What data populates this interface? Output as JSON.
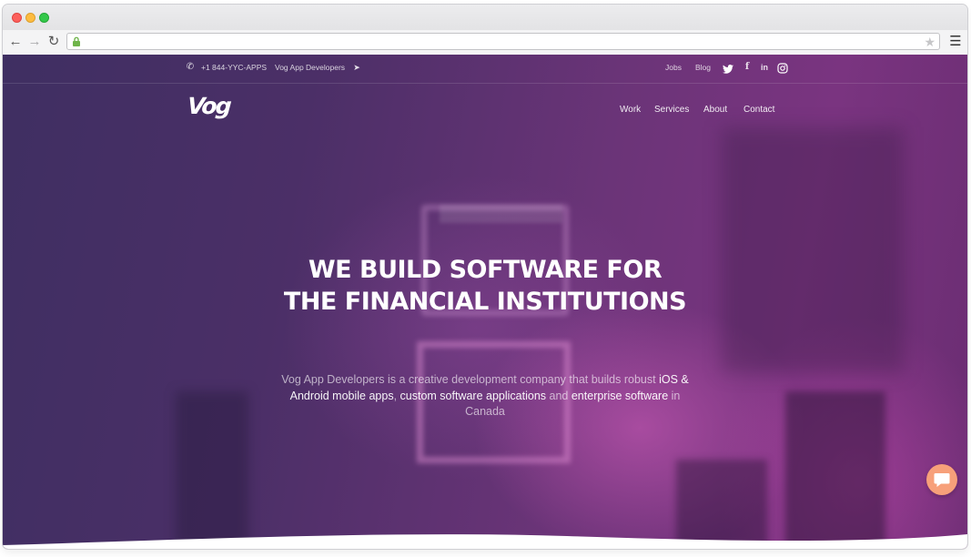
{
  "browser": {
    "url": "",
    "icons": {
      "back": "arrow-left-icon",
      "forward": "arrow-right-icon",
      "reload": "reload-icon",
      "lock": "lock-icon",
      "bookmark": "star-icon",
      "menu": "hamburger-menu-icon"
    }
  },
  "topbar": {
    "phone": "+1 844-YYC-APPS",
    "company_link": "Vog App Developers",
    "jobs": "Jobs",
    "blog": "Blog",
    "social": [
      "twitter-icon",
      "facebook-icon",
      "linkedin-icon",
      "instagram-icon"
    ]
  },
  "header": {
    "logo": "Vog",
    "nav": [
      "Work",
      "Services",
      "About",
      "Contact"
    ]
  },
  "hero": {
    "headline_line1": "WE BUILD SOFTWARE FOR",
    "headline_line2": "THE FINANCIAL INSTITUTIONS",
    "sub_part1": "Vog App Developers is a creative development company that builds robust ",
    "sub_hl1": "iOS & Android mobile apps",
    "sub_part2": ", ",
    "sub_hl2": "custom software applications",
    "sub_part3": " and ",
    "sub_hl3": "enterprise software",
    "sub_part4": " in Canada"
  },
  "colors": {
    "accent_chat": "#f7a07a",
    "hero_dark": "#3f2f62",
    "hero_magenta": "#7a3480"
  }
}
